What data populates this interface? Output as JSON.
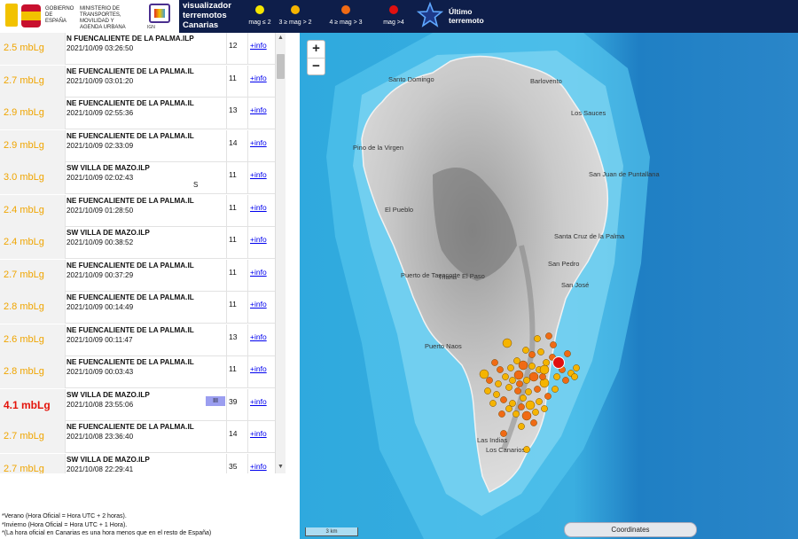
{
  "header": {
    "gov_text": "GOBIERNO DE ESPAÑA",
    "ministry_text": "MINISTERIO DE TRANSPORTES, MOVILIDAD Y AGENDA URBANA",
    "ign_text": "IGN",
    "title": "visualizador terremotos Canarias",
    "legend": [
      {
        "label": "mag ≤ 2",
        "color": "#f5e600"
      },
      {
        "label": "3 ≥ mag > 2",
        "color": "#f5b400"
      },
      {
        "label": "4 ≥ mag > 3",
        "color": "#f06a14"
      },
      {
        "label": "mag >4",
        "color": "#e01010"
      }
    ],
    "last_quake_label": "Último terremoto"
  },
  "quakes": [
    {
      "mag": "2.5 mbLg",
      "place": "N FUENCALIENTE DE LA PALMA.ILP",
      "date": "2021/10/09 03:26:50",
      "depth": "12",
      "info": "+info",
      "flag": "",
      "intensity": ""
    },
    {
      "mag": "2.7 mbLg",
      "place": "NE FUENCALIENTE DE LA PALMA.IL",
      "date": "2021/10/09 03:01:20",
      "depth": "11",
      "info": "+info",
      "flag": "",
      "intensity": ""
    },
    {
      "mag": "2.9 mbLg",
      "place": "NE FUENCALIENTE DE LA PALMA.IL",
      "date": "2021/10/09 02:55:36",
      "depth": "13",
      "info": "+info",
      "flag": "",
      "intensity": ""
    },
    {
      "mag": "2.9 mbLg",
      "place": "NE FUENCALIENTE DE LA PALMA.IL",
      "date": "2021/10/09 02:33:09",
      "depth": "14",
      "info": "+info",
      "flag": "",
      "intensity": ""
    },
    {
      "mag": "3.0 mbLg",
      "place": "SW VILLA DE MAZO.ILP",
      "date": "2021/10/09 02:02:43",
      "depth": "11",
      "info": "+info",
      "flag": "S",
      "intensity": ""
    },
    {
      "mag": "2.4 mbLg",
      "place": "NE FUENCALIENTE DE LA PALMA.IL",
      "date": "2021/10/09 01:28:50",
      "depth": "11",
      "info": "+info",
      "flag": "",
      "intensity": ""
    },
    {
      "mag": "2.4 mbLg",
      "place": "SW VILLA DE MAZO.ILP",
      "date": "2021/10/09 00:38:52",
      "depth": "11",
      "info": "+info",
      "flag": "",
      "intensity": ""
    },
    {
      "mag": "2.7 mbLg",
      "place": "NE FUENCALIENTE DE LA PALMA.IL",
      "date": "2021/10/09 00:37:29",
      "depth": "11",
      "info": "+info",
      "flag": "",
      "intensity": ""
    },
    {
      "mag": "2.8 mbLg",
      "place": "NE FUENCALIENTE DE LA PALMA.IL",
      "date": "2021/10/09 00:14:49",
      "depth": "11",
      "info": "+info",
      "flag": "",
      "intensity": ""
    },
    {
      "mag": "2.6 mbLg",
      "place": "NE FUENCALIENTE DE LA PALMA.IL",
      "date": "2021/10/09 00:11:47",
      "depth": "13",
      "info": "+info",
      "flag": "",
      "intensity": ""
    },
    {
      "mag": "2.8 mbLg",
      "place": "NE FUENCALIENTE DE LA PALMA.IL",
      "date": "2021/10/09 00:03:43",
      "depth": "11",
      "info": "+info",
      "flag": "",
      "intensity": ""
    },
    {
      "mag": "4.1 mbLg",
      "place": "SW VILLA DE MAZO.ILP",
      "date": "2021/10/08 23:55:06",
      "depth": "39",
      "info": "+info",
      "flag": "",
      "intensity": "III",
      "big": true
    },
    {
      "mag": "2.7 mbLg",
      "place": "NE FUENCALIENTE DE LA PALMA.IL",
      "date": "2021/10/08 23:36:40",
      "depth": "14",
      "info": "+info",
      "flag": "",
      "intensity": ""
    },
    {
      "mag": "2.7 mbLg",
      "place": "SW VILLA DE MAZO.ILP",
      "date": "2021/10/08 22:29:41",
      "depth": "35",
      "info": "+info",
      "flag": "",
      "intensity": ""
    }
  ],
  "notes": [
    "*Verano (Hora Oficial = Hora UTC + 2 horas).",
    "*Invierno (Hora Oficial = Hora UTC + 1 Hora).",
    "*(La hora oficial en Canarias es una hora menos que en el resto de España)"
  ],
  "map": {
    "zoom_in": "+",
    "zoom_out": "−",
    "scale": "3 km",
    "coords_label": "Coordinates",
    "places": [
      {
        "name": "Santo Domingo"
      },
      {
        "name": "Barlovento"
      },
      {
        "name": "Los Sauces"
      },
      {
        "name": "Pino de la Virgen"
      },
      {
        "name": "San Juan de Puntallana"
      },
      {
        "name": "El Pueblo"
      },
      {
        "name": "Santa Cruz de la Palma"
      },
      {
        "name": "San Pedro"
      },
      {
        "name": "Puerto de Tazacorte"
      },
      {
        "name": "Triana"
      },
      {
        "name": "El Paso"
      },
      {
        "name": "San José"
      },
      {
        "name": "Puerto Naos"
      },
      {
        "name": "Las Indias"
      },
      {
        "name": "Los Canarios"
      }
    ]
  }
}
